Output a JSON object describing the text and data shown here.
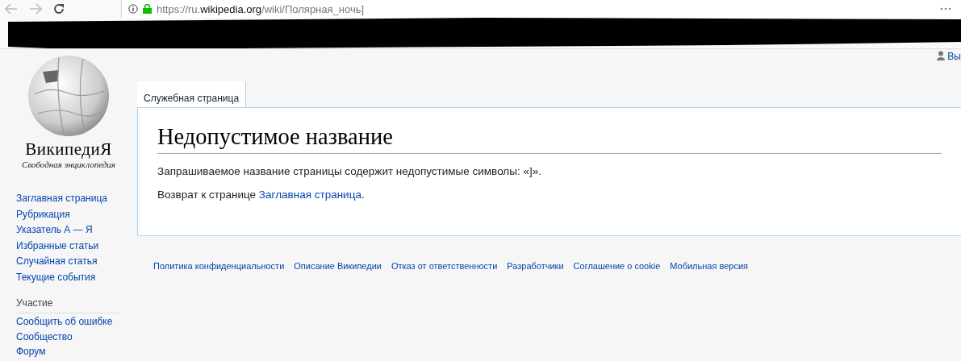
{
  "browser": {
    "url": {
      "prefix": "https://ru.",
      "domain": "wikipedia.org",
      "path": "/wiki/Полярная_ночь]"
    }
  },
  "personal": {
    "user": "Вы"
  },
  "logo": {
    "wordmark": "ВикипедиЯ",
    "tagline": "Свободная энциклопедия"
  },
  "sidebar": {
    "navigation": [
      "Заглавная страница",
      "Рубрикация",
      "Указатель А — Я",
      "Избранные статьи",
      "Случайная статья",
      "Текущие события"
    ],
    "sections": [
      {
        "heading": "Участие",
        "items": [
          "Сообщить об ошибке",
          "Сообщество",
          "Форум"
        ]
      }
    ]
  },
  "tabs": [
    {
      "label": "Служебная страница",
      "selected": true
    }
  ],
  "content": {
    "title": "Недопустимое название",
    "message": "Запрашиваемое название страницы содержит недопустимые символы: «]».",
    "return_text": "Возврат к странице",
    "return_link": "Заглавная страница",
    "return_end": "."
  },
  "footer": {
    "links": [
      "Политика конфиденциальности",
      "Описание Википедии",
      "Отказ от ответственности",
      "Разработчики",
      "Соглашение о cookie",
      "Мобильная версия"
    ]
  }
}
